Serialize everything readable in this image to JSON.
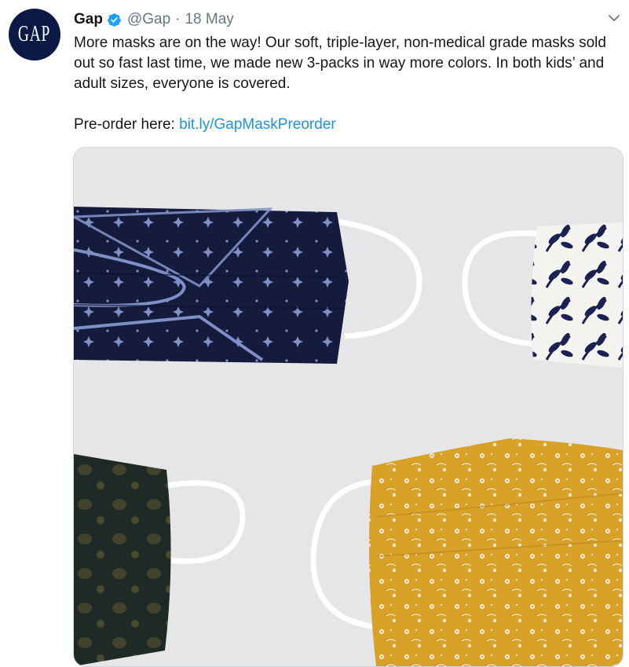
{
  "tweet": {
    "author_name": "Gap",
    "handle": "@Gap",
    "separator": "·",
    "date": "18 May",
    "avatar_text": "GAP",
    "text_line1": "More masks are on the way! Our soft, triple-layer, non-medical grade masks sold out so fast last time, we made new 3-packs in way more colors. In both kids’ and adult sizes, everyone is covered.",
    "text_prefix": "Pre-order here: ",
    "link_text": "bit.ly/GapMaskPreorder"
  },
  "icons": {
    "verified": "verified-badge-icon",
    "caret": "chevron-down-icon"
  },
  "colors": {
    "avatar_bg": "#0b1a44",
    "link": "#1b95e0",
    "verified": "#1da1f2",
    "muted": "#657786",
    "mask_navy": "#141b3c",
    "mask_pattern": "#8a9bd0",
    "mask_yellow": "#d8a228",
    "mask_dark_green": "#1e2a26"
  }
}
